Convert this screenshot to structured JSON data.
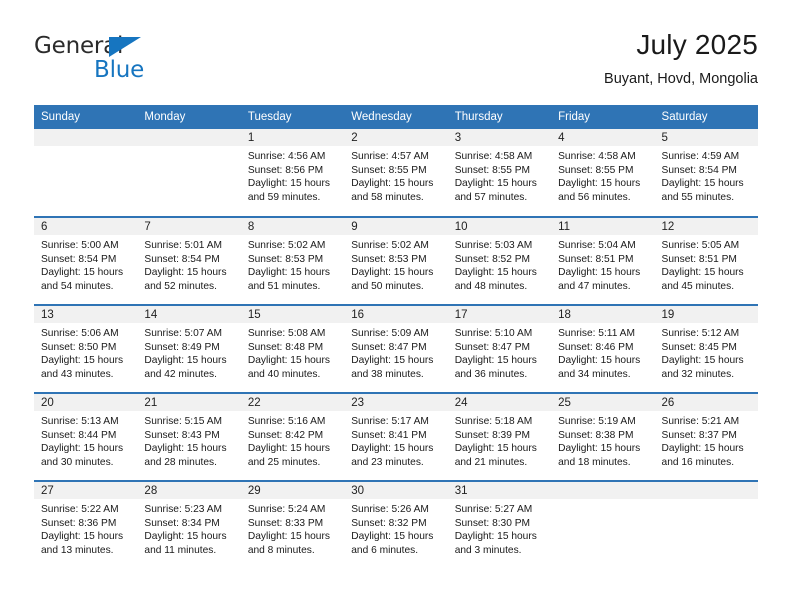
{
  "brand": {
    "name_part1": "General",
    "name_part2": "Blue",
    "triangle_icon": "triangle-icon"
  },
  "header": {
    "title": "July 2025",
    "location": "Buyant, Hovd, Mongolia"
  },
  "colors": {
    "header_blue": "#2f74b5",
    "brand_blue": "#1675c0",
    "daynum_band": "#f1f1f1",
    "text": "#1a1a1a"
  },
  "weekday_headers": [
    "Sunday",
    "Monday",
    "Tuesday",
    "Wednesday",
    "Thursday",
    "Friday",
    "Saturday"
  ],
  "weeks": [
    [
      {
        "day": "",
        "sunrise": "",
        "sunset": "",
        "daylight_line1": "",
        "daylight_line2": ""
      },
      {
        "day": "",
        "sunrise": "",
        "sunset": "",
        "daylight_line1": "",
        "daylight_line2": ""
      },
      {
        "day": "1",
        "sunrise": "Sunrise: 4:56 AM",
        "sunset": "Sunset: 8:56 PM",
        "daylight_line1": "Daylight: 15 hours",
        "daylight_line2": "and 59 minutes."
      },
      {
        "day": "2",
        "sunrise": "Sunrise: 4:57 AM",
        "sunset": "Sunset: 8:55 PM",
        "daylight_line1": "Daylight: 15 hours",
        "daylight_line2": "and 58 minutes."
      },
      {
        "day": "3",
        "sunrise": "Sunrise: 4:58 AM",
        "sunset": "Sunset: 8:55 PM",
        "daylight_line1": "Daylight: 15 hours",
        "daylight_line2": "and 57 minutes."
      },
      {
        "day": "4",
        "sunrise": "Sunrise: 4:58 AM",
        "sunset": "Sunset: 8:55 PM",
        "daylight_line1": "Daylight: 15 hours",
        "daylight_line2": "and 56 minutes."
      },
      {
        "day": "5",
        "sunrise": "Sunrise: 4:59 AM",
        "sunset": "Sunset: 8:54 PM",
        "daylight_line1": "Daylight: 15 hours",
        "daylight_line2": "and 55 minutes."
      }
    ],
    [
      {
        "day": "6",
        "sunrise": "Sunrise: 5:00 AM",
        "sunset": "Sunset: 8:54 PM",
        "daylight_line1": "Daylight: 15 hours",
        "daylight_line2": "and 54 minutes."
      },
      {
        "day": "7",
        "sunrise": "Sunrise: 5:01 AM",
        "sunset": "Sunset: 8:54 PM",
        "daylight_line1": "Daylight: 15 hours",
        "daylight_line2": "and 52 minutes."
      },
      {
        "day": "8",
        "sunrise": "Sunrise: 5:02 AM",
        "sunset": "Sunset: 8:53 PM",
        "daylight_line1": "Daylight: 15 hours",
        "daylight_line2": "and 51 minutes."
      },
      {
        "day": "9",
        "sunrise": "Sunrise: 5:02 AM",
        "sunset": "Sunset: 8:53 PM",
        "daylight_line1": "Daylight: 15 hours",
        "daylight_line2": "and 50 minutes."
      },
      {
        "day": "10",
        "sunrise": "Sunrise: 5:03 AM",
        "sunset": "Sunset: 8:52 PM",
        "daylight_line1": "Daylight: 15 hours",
        "daylight_line2": "and 48 minutes."
      },
      {
        "day": "11",
        "sunrise": "Sunrise: 5:04 AM",
        "sunset": "Sunset: 8:51 PM",
        "daylight_line1": "Daylight: 15 hours",
        "daylight_line2": "and 47 minutes."
      },
      {
        "day": "12",
        "sunrise": "Sunrise: 5:05 AM",
        "sunset": "Sunset: 8:51 PM",
        "daylight_line1": "Daylight: 15 hours",
        "daylight_line2": "and 45 minutes."
      }
    ],
    [
      {
        "day": "13",
        "sunrise": "Sunrise: 5:06 AM",
        "sunset": "Sunset: 8:50 PM",
        "daylight_line1": "Daylight: 15 hours",
        "daylight_line2": "and 43 minutes."
      },
      {
        "day": "14",
        "sunrise": "Sunrise: 5:07 AM",
        "sunset": "Sunset: 8:49 PM",
        "daylight_line1": "Daylight: 15 hours",
        "daylight_line2": "and 42 minutes."
      },
      {
        "day": "15",
        "sunrise": "Sunrise: 5:08 AM",
        "sunset": "Sunset: 8:48 PM",
        "daylight_line1": "Daylight: 15 hours",
        "daylight_line2": "and 40 minutes."
      },
      {
        "day": "16",
        "sunrise": "Sunrise: 5:09 AM",
        "sunset": "Sunset: 8:47 PM",
        "daylight_line1": "Daylight: 15 hours",
        "daylight_line2": "and 38 minutes."
      },
      {
        "day": "17",
        "sunrise": "Sunrise: 5:10 AM",
        "sunset": "Sunset: 8:47 PM",
        "daylight_line1": "Daylight: 15 hours",
        "daylight_line2": "and 36 minutes."
      },
      {
        "day": "18",
        "sunrise": "Sunrise: 5:11 AM",
        "sunset": "Sunset: 8:46 PM",
        "daylight_line1": "Daylight: 15 hours",
        "daylight_line2": "and 34 minutes."
      },
      {
        "day": "19",
        "sunrise": "Sunrise: 5:12 AM",
        "sunset": "Sunset: 8:45 PM",
        "daylight_line1": "Daylight: 15 hours",
        "daylight_line2": "and 32 minutes."
      }
    ],
    [
      {
        "day": "20",
        "sunrise": "Sunrise: 5:13 AM",
        "sunset": "Sunset: 8:44 PM",
        "daylight_line1": "Daylight: 15 hours",
        "daylight_line2": "and 30 minutes."
      },
      {
        "day": "21",
        "sunrise": "Sunrise: 5:15 AM",
        "sunset": "Sunset: 8:43 PM",
        "daylight_line1": "Daylight: 15 hours",
        "daylight_line2": "and 28 minutes."
      },
      {
        "day": "22",
        "sunrise": "Sunrise: 5:16 AM",
        "sunset": "Sunset: 8:42 PM",
        "daylight_line1": "Daylight: 15 hours",
        "daylight_line2": "and 25 minutes."
      },
      {
        "day": "23",
        "sunrise": "Sunrise: 5:17 AM",
        "sunset": "Sunset: 8:41 PM",
        "daylight_line1": "Daylight: 15 hours",
        "daylight_line2": "and 23 minutes."
      },
      {
        "day": "24",
        "sunrise": "Sunrise: 5:18 AM",
        "sunset": "Sunset: 8:39 PM",
        "daylight_line1": "Daylight: 15 hours",
        "daylight_line2": "and 21 minutes."
      },
      {
        "day": "25",
        "sunrise": "Sunrise: 5:19 AM",
        "sunset": "Sunset: 8:38 PM",
        "daylight_line1": "Daylight: 15 hours",
        "daylight_line2": "and 18 minutes."
      },
      {
        "day": "26",
        "sunrise": "Sunrise: 5:21 AM",
        "sunset": "Sunset: 8:37 PM",
        "daylight_line1": "Daylight: 15 hours",
        "daylight_line2": "and 16 minutes."
      }
    ],
    [
      {
        "day": "27",
        "sunrise": "Sunrise: 5:22 AM",
        "sunset": "Sunset: 8:36 PM",
        "daylight_line1": "Daylight: 15 hours",
        "daylight_line2": "and 13 minutes."
      },
      {
        "day": "28",
        "sunrise": "Sunrise: 5:23 AM",
        "sunset": "Sunset: 8:34 PM",
        "daylight_line1": "Daylight: 15 hours",
        "daylight_line2": "and 11 minutes."
      },
      {
        "day": "29",
        "sunrise": "Sunrise: 5:24 AM",
        "sunset": "Sunset: 8:33 PM",
        "daylight_line1": "Daylight: 15 hours",
        "daylight_line2": "and 8 minutes."
      },
      {
        "day": "30",
        "sunrise": "Sunrise: 5:26 AM",
        "sunset": "Sunset: 8:32 PM",
        "daylight_line1": "Daylight: 15 hours",
        "daylight_line2": "and 6 minutes."
      },
      {
        "day": "31",
        "sunrise": "Sunrise: 5:27 AM",
        "sunset": "Sunset: 8:30 PM",
        "daylight_line1": "Daylight: 15 hours",
        "daylight_line2": "and 3 minutes."
      },
      {
        "day": "",
        "sunrise": "",
        "sunset": "",
        "daylight_line1": "",
        "daylight_line2": ""
      },
      {
        "day": "",
        "sunrise": "",
        "sunset": "",
        "daylight_line1": "",
        "daylight_line2": ""
      }
    ]
  ]
}
